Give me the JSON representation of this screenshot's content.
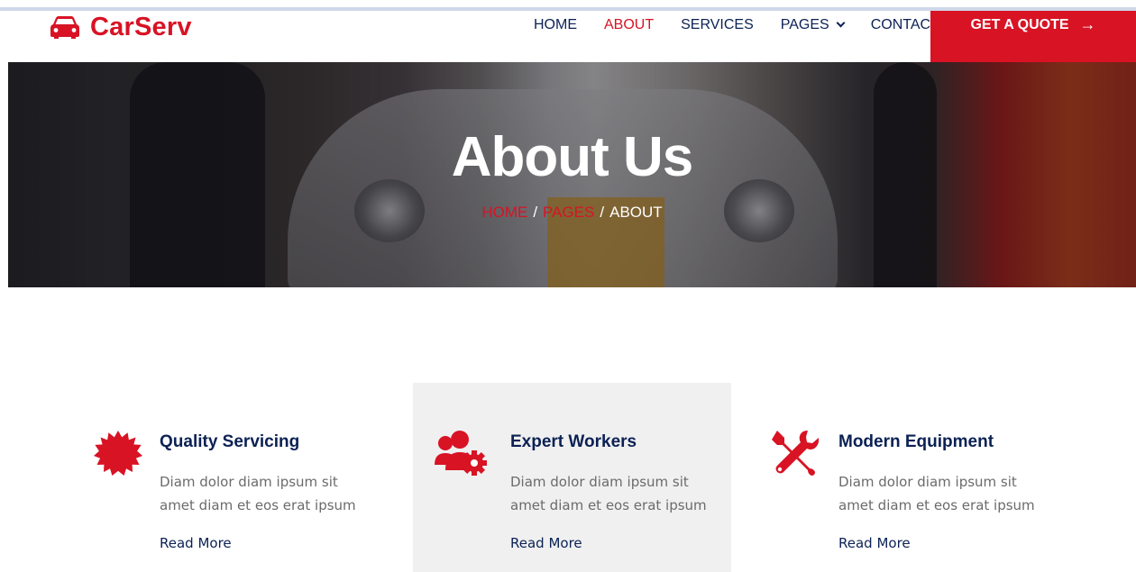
{
  "brand": {
    "name": "CarServ",
    "icon": "car-icon",
    "color": "#d81324"
  },
  "nav": {
    "items": [
      {
        "label": "HOME",
        "active": false
      },
      {
        "label": "ABOUT",
        "active": true
      },
      {
        "label": "SERVICES",
        "active": false
      },
      {
        "label": "PAGES",
        "active": false,
        "dropdown": true
      },
      {
        "label": "CONTACT",
        "active": false
      }
    ],
    "cta_label": "GET A QUOTE",
    "cta_icon": "arrow-right-icon"
  },
  "hero": {
    "title": "About Us",
    "breadcrumb": [
      "HOME",
      "PAGES",
      "ABOUT"
    ],
    "breadcrumb_separator": "/"
  },
  "features": [
    {
      "icon": "certificate-icon",
      "title": "Quality Servicing",
      "description": "Diam dolor diam ipsum sit amet diam et eos erat ipsum",
      "link": "Read More"
    },
    {
      "icon": "users-cog-icon",
      "title": "Expert Workers",
      "description": "Diam dolor diam ipsum sit amet diam et eos erat ipsum",
      "link": "Read More"
    },
    {
      "icon": "tools-icon",
      "title": "Modern Equipment",
      "description": "Diam dolor diam ipsum sit amet diam et eos erat ipsum",
      "link": "Read More"
    }
  ],
  "colors": {
    "primary": "#d81324",
    "dark": "#0b2154",
    "muted": "#6b6b6b",
    "light_bg": "#f0f0f0"
  }
}
